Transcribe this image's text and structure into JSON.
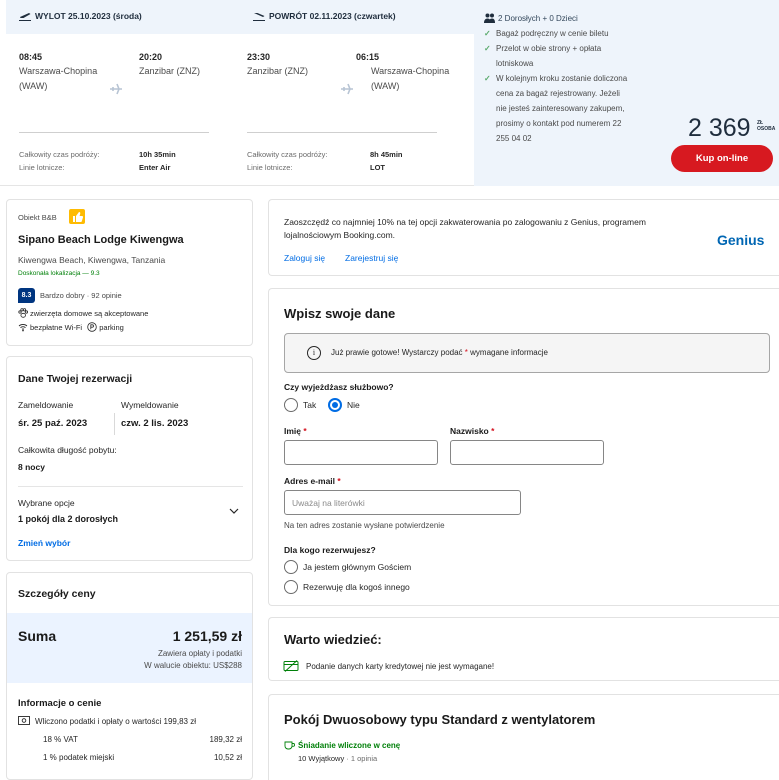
{
  "flight": {
    "outbound": {
      "header": "WYLOT 25.10.2023 (środa)",
      "depart_time": "08:45",
      "depart_city": "Warszawa-Chopina",
      "depart_code": "(WAW)",
      "arrive_time": "20:20",
      "arrive_city": "Zanzibar (ZNZ)",
      "duration_label": "Całkowity czas podróży:",
      "duration": "10h 35min",
      "airline_label": "Linie lotnicze:",
      "airline": "Enter Air"
    },
    "return": {
      "header": "POWRÓT 02.11.2023 (czwartek)",
      "depart_time": "23:30",
      "depart_city": "Zanzibar (ZNZ)",
      "arrive_time": "06:15",
      "arrive_city": "Warszawa-Chopina",
      "arrive_code": "(WAW)",
      "duration_label": "Całkowity czas podróży:",
      "duration": "8h 45min",
      "airline_label": "Linie lotnicze:",
      "airline": "LOT"
    },
    "summary": {
      "passengers": "2 Dorosłych + 0 Dzieci",
      "bullets": [
        [
          "Bagaż podręczny w cenie biletu"
        ],
        [
          "Przelot w obie strony + opłata",
          "lotniskowa"
        ],
        [
          "W kolejnym kroku zostanie doliczona",
          "cena za bagaż rejestrowany. Jeżeli",
          "nie jesteś zainteresowany zakupem,",
          "prosimy o kontakt pod numerem 22",
          "255 04 02"
        ]
      ],
      "price": "2 369",
      "currency_line1": "ZŁ",
      "currency_line2": "OSOBA",
      "buy_label": "Kup on-line"
    }
  },
  "property": {
    "type": "Obiekt B&B",
    "name": "Sipano Beach Lodge Kiwengwa",
    "address": "Kiwengwa Beach, Kiwengwa, Tanzania",
    "location": "Doskonała lokalizacja — 9.3",
    "score": "8.3",
    "reviews": "Bardzo dobry · 92 opinie",
    "facility1": "zwierzęta domowe są akceptowane",
    "facility2": "bezpłatne Wi-Fi",
    "facility3": "parking"
  },
  "reservation": {
    "title": "Dane Twojej rezerwacji",
    "checkin_label": "Zameldowanie",
    "checkout_label": "Wymeldowanie",
    "checkin": "śr. 25 paź. 2023",
    "checkout": "czw. 2 lis. 2023",
    "length_label": "Całkowita długość pobytu:",
    "length": "8 nocy",
    "options_label": "Wybrane opcje",
    "options": "1 pokój dla 2 dorosłych",
    "change_link": "Zmień wybór"
  },
  "price": {
    "title": "Szczegóły ceny",
    "sum_label": "Suma",
    "total": "1 251,59 zł",
    "includes": "Zawiera opłaty i podatki",
    "local_currency": "W walucie obiektu: US$288",
    "info_title": "Informacje o cenie",
    "included_taxes": "Wliczono podatki i opłaty o wartości 199,83 zł",
    "vat_label": "18 % VAT",
    "vat_value": "189,32 zł",
    "city_tax_label": "1 % podatek miejski",
    "city_tax_value": "10,52 zł"
  },
  "genius": {
    "text": "Zaoszczędź co najmniej 10% na tej opcji zakwaterowania po zalogowaniu z Genius, programem lojalnościowym Booking.com.",
    "logo": "Genius",
    "login": "Zaloguj się",
    "register": "Zarejestruj się"
  },
  "form": {
    "title": "Wpisz swoje dane",
    "info_pre": "Już prawie gotowe! Wystarczy podać",
    "info_star": "*",
    "info_post": "wymagane informacje",
    "business_q": "Czy wyjeżdżasz służbowo?",
    "yes": "Tak",
    "no": "Nie",
    "first_name_label": "Imię",
    "last_name_label": "Nazwisko",
    "star": "*",
    "email_label": "Adres e-mail",
    "email_placeholder": "Uważaj na literówki",
    "email_hint": "Na ten adres zostanie wysłane potwierdzenie",
    "for_whom_q": "Dla kogo rezerwujesz?",
    "main_guest": "Ja jestem głównym Gościem",
    "other_guest": "Rezerwuję dla kogoś innego"
  },
  "good_to_know": {
    "title": "Warto wiedzieć:",
    "text": "Podanie danych karty kredytowej nie jest wymagane!"
  },
  "room": {
    "title": "Pokój Dwuosobowy typu Standard z wentylatorem",
    "breakfast": "Śniadanie wliczone w cenę",
    "review_score": "10 Wyjątkowy",
    "review_count": "· 1 opinia"
  },
  "colors": {
    "primary_blue": "#006ce4",
    "score_blue": "#003580",
    "buy_red": "#d71920",
    "green": "#008009",
    "light_blue_bg": "#eef4fb"
  }
}
